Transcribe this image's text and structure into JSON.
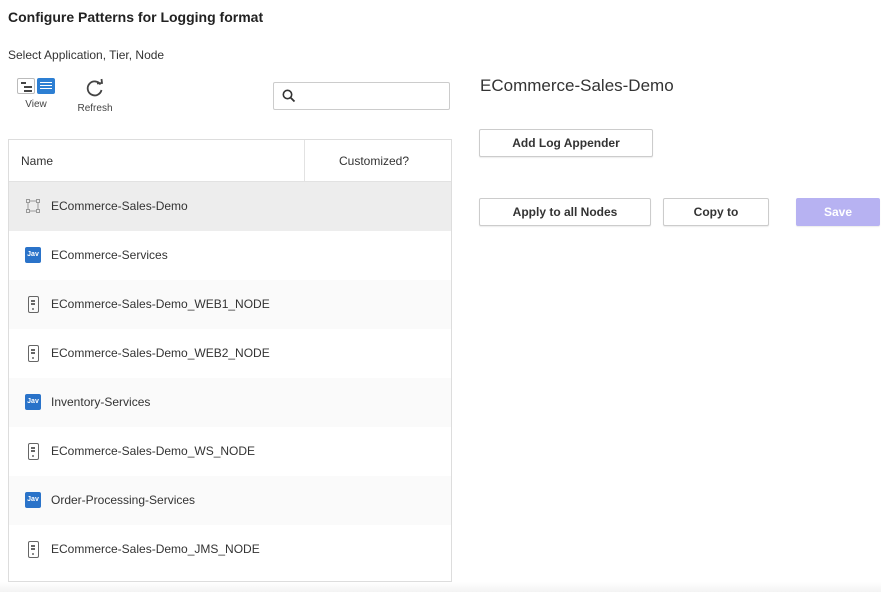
{
  "header": {
    "title": "Configure Patterns for Logging format",
    "subtitle": "Select Application, Tier, Node"
  },
  "toolbar": {
    "view_label": "View",
    "refresh_label": "Refresh"
  },
  "search": {
    "value": "",
    "placeholder": ""
  },
  "table": {
    "columns": [
      "Name",
      "Customized?"
    ],
    "rows": [
      {
        "icon": "application-icon",
        "label": "ECommerce-Sales-Demo",
        "customized": "",
        "selected": true
      },
      {
        "icon": "java-tier-icon",
        "label": "ECommerce-Services",
        "customized": ""
      },
      {
        "icon": "node-icon",
        "label": "ECommerce-Sales-Demo_WEB1_NODE",
        "customized": ""
      },
      {
        "icon": "node-icon",
        "label": "ECommerce-Sales-Demo_WEB2_NODE",
        "customized": ""
      },
      {
        "icon": "java-tier-icon",
        "label": "Inventory-Services",
        "customized": ""
      },
      {
        "icon": "node-icon",
        "label": "ECommerce-Sales-Demo_WS_NODE",
        "customized": ""
      },
      {
        "icon": "java-tier-icon",
        "label": "Order-Processing-Services",
        "customized": ""
      },
      {
        "icon": "node-icon",
        "label": "ECommerce-Sales-Demo_JMS_NODE",
        "customized": ""
      }
    ],
    "java_badge_text": "Jav"
  },
  "detail": {
    "title": "ECommerce-Sales-Demo",
    "add_log_appender_label": "Add Log Appender",
    "apply_all_label": "Apply to all Nodes",
    "copy_to_label": "Copy to",
    "save_label": "Save"
  },
  "colors": {
    "accent": "#2d7fd3",
    "java_badge": "#2a73c9",
    "save_disabled": "#b7b2f2",
    "selected_row": "#ededed"
  }
}
